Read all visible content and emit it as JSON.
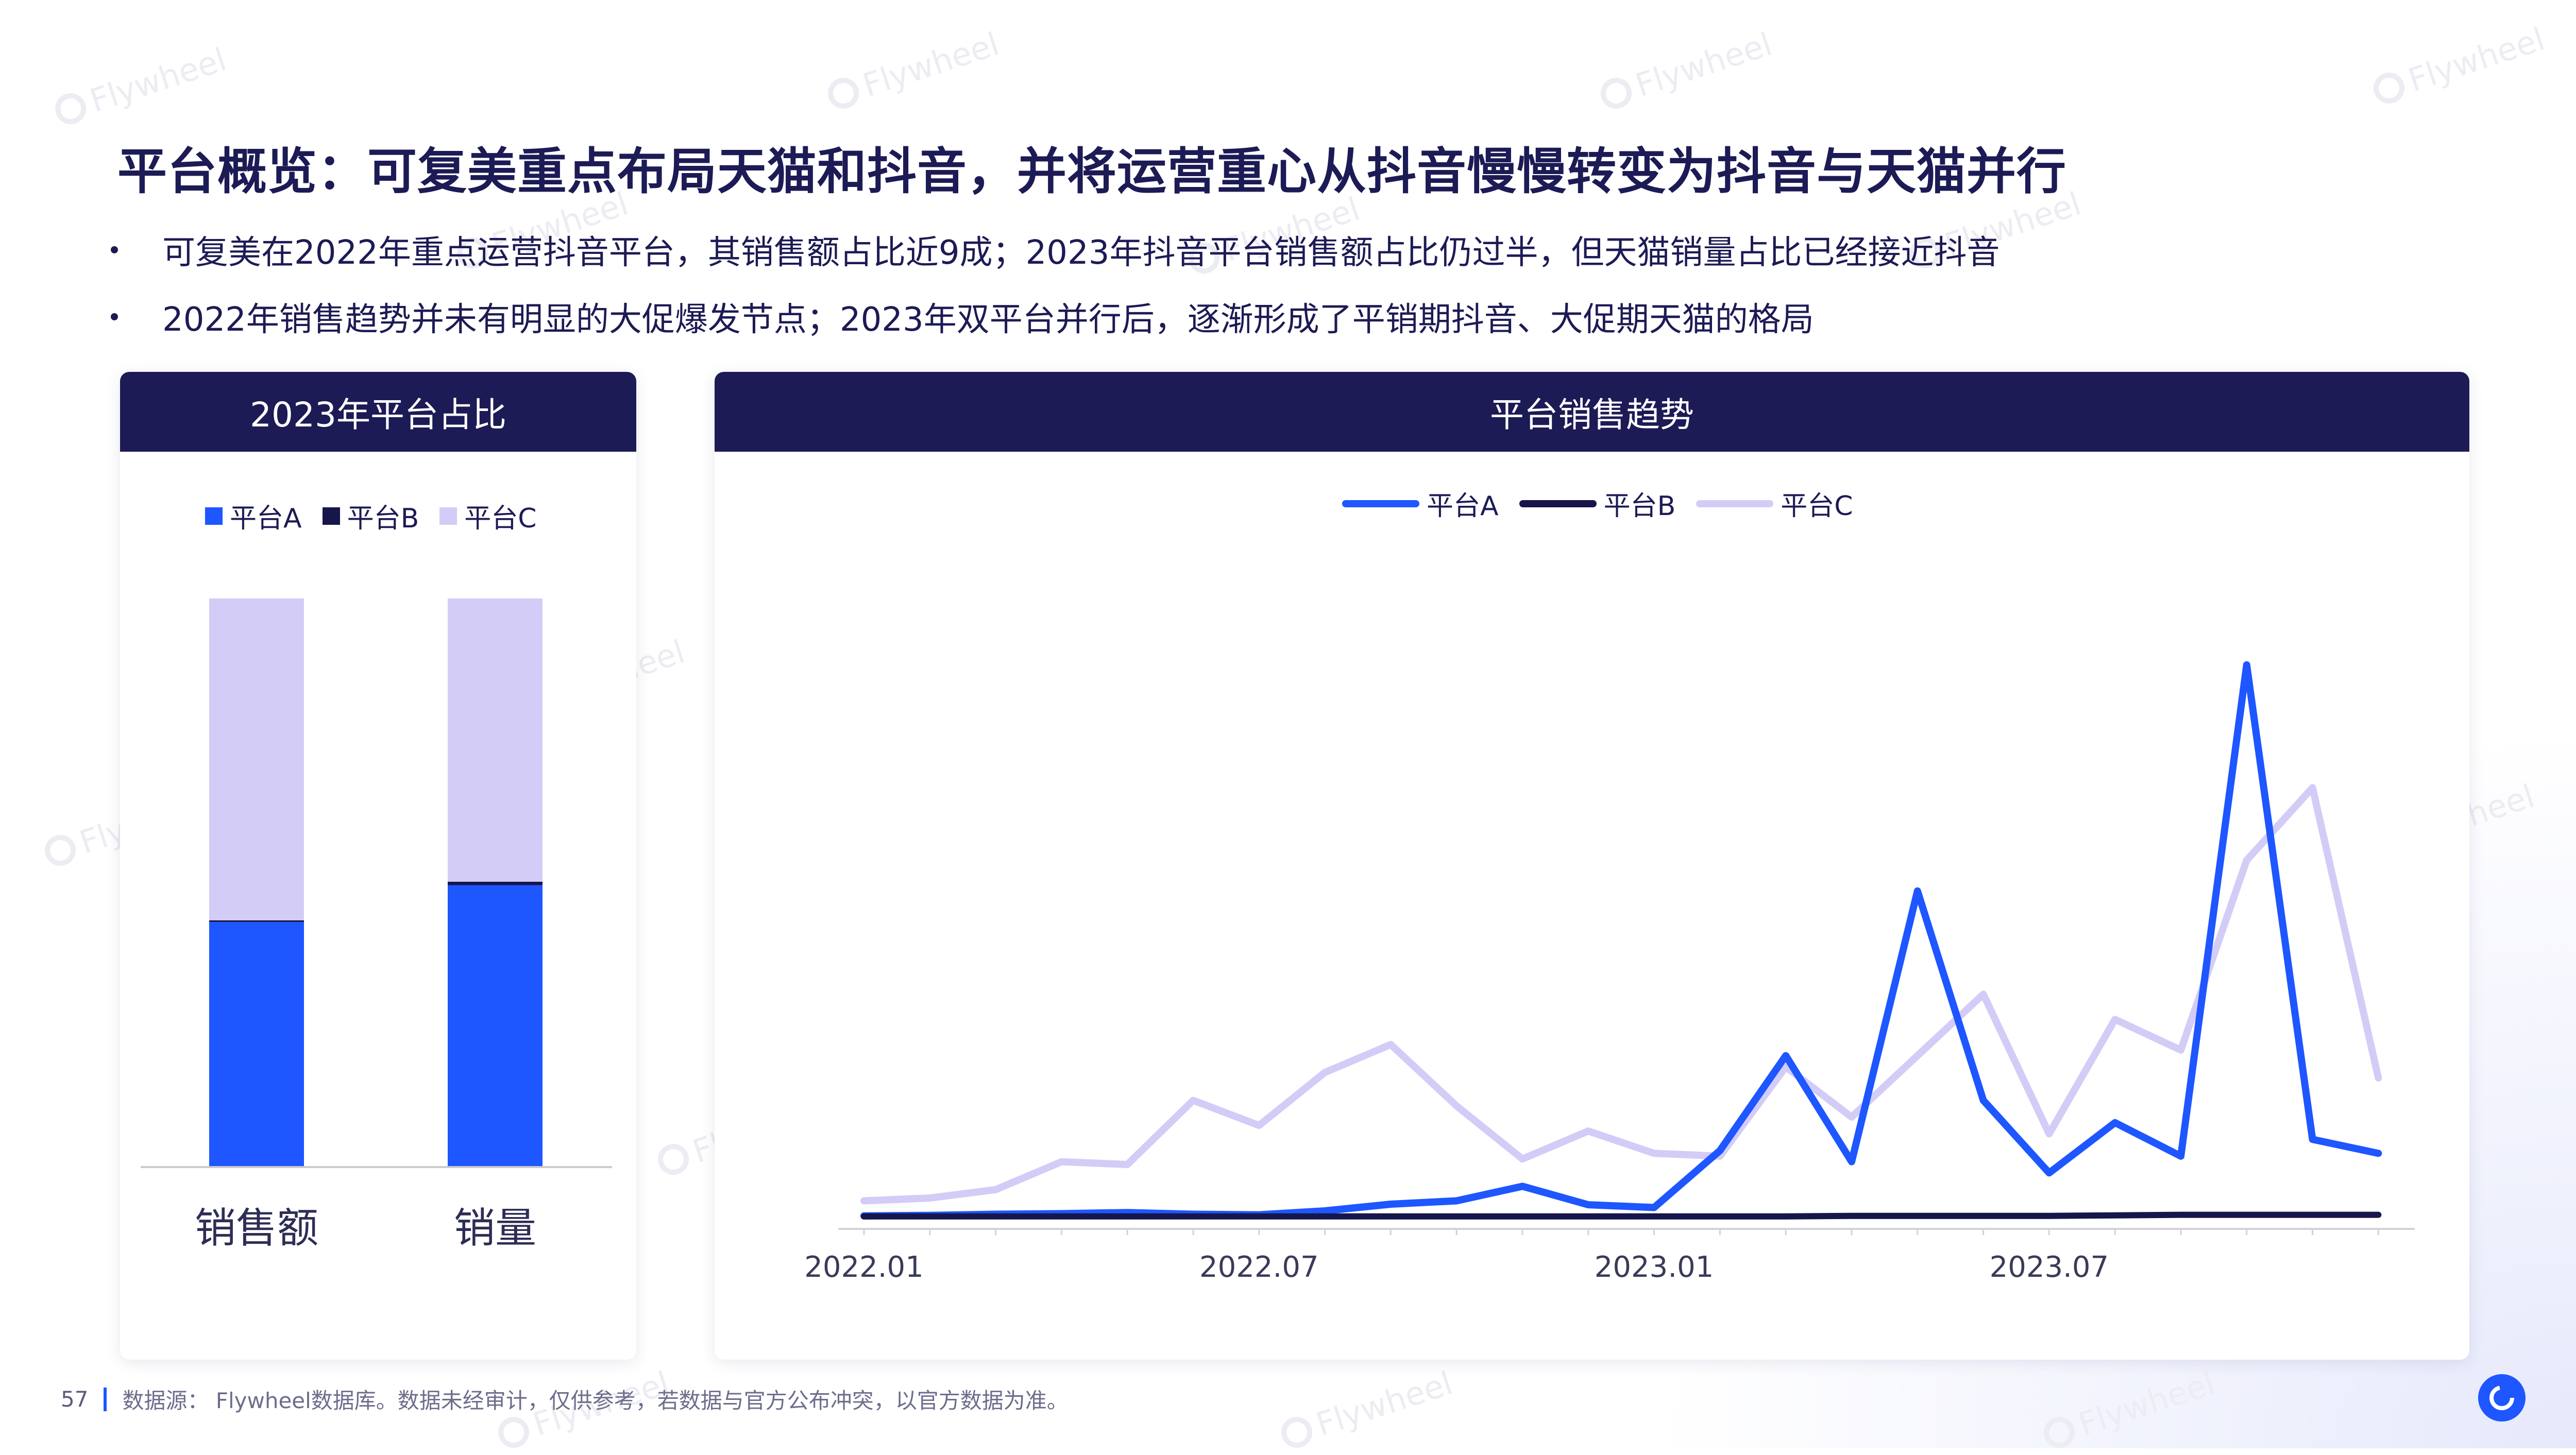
{
  "title": "平台概览：可复美重点布局天猫和抖音，并将运营重心从抖音慢慢转变为抖音与天猫并行",
  "bullets": [
    "可复美在2022年重点运营抖音平台，其销售额占比近9成；2023年抖音平台销售额占比仍过半，但天猫销量占比已经接近抖音",
    "2022年销售趋势并未有明显的大促爆发节点；2023年双平台并行后，逐渐形成了平销期抖音、大促期天猫的格局"
  ],
  "watermark": "Flywheel",
  "colors": {
    "A": "#1e56ff",
    "B": "#16164a",
    "C": "#d3ccf7",
    "header": "#1c1b55"
  },
  "footer": {
    "page": "57",
    "source": "数据源： Flywheel数据库。数据未经审计，仅供参考，若数据与官方公布冲突，以官方数据为准。"
  },
  "chart_data": [
    {
      "type": "bar",
      "stacked": true,
      "title": "2023年平台占比",
      "categories": [
        "销售额",
        "销量"
      ],
      "series": [
        {
          "name": "平台A",
          "values": [
            43,
            49.5
          ]
        },
        {
          "name": "平台B",
          "values": [
            0.3,
            0.6
          ]
        },
        {
          "name": "平台C",
          "values": [
            56.7,
            49.9
          ]
        }
      ],
      "ylim": [
        0,
        100
      ],
      "legend": "top"
    },
    {
      "type": "line",
      "title": "平台销售趋势",
      "x": [
        "2022.01",
        "2022.02",
        "2022.03",
        "2022.04",
        "2022.05",
        "2022.06",
        "2022.07",
        "2022.08",
        "2022.09",
        "2022.10",
        "2022.11",
        "2022.12",
        "2023.01",
        "2023.02",
        "2023.03",
        "2023.04",
        "2023.05",
        "2023.06",
        "2023.07",
        "2023.08",
        "2023.09",
        "2023.10",
        "2023.11",
        "2023.12"
      ],
      "xticks": [
        "2022.01",
        "2022.07",
        "2023.01",
        "2023.07"
      ],
      "series": [
        {
          "name": "平台A",
          "values": [
            0.3,
            0.4,
            0.6,
            0.7,
            0.9,
            0.6,
            0.5,
            1.2,
            2.4,
            3.0,
            5.6,
            2.3,
            1.8,
            12.0,
            29.0,
            10.0,
            58.5,
            21.0,
            8.0,
            17.0,
            11.0,
            99.0,
            14.0,
            11.5
          ]
        },
        {
          "name": "平台B",
          "values": [
            0.2,
            0.2,
            0.2,
            0.2,
            0.2,
            0.2,
            0.2,
            0.2,
            0.2,
            0.2,
            0.2,
            0.2,
            0.2,
            0.2,
            0.2,
            0.3,
            0.3,
            0.3,
            0.3,
            0.4,
            0.5,
            0.5,
            0.5,
            0.5
          ]
        },
        {
          "name": "平台C",
          "values": [
            3.0,
            3.5,
            5.0,
            10.0,
            9.5,
            21.0,
            16.5,
            26.0,
            31.0,
            20.0,
            10.5,
            15.5,
            11.5,
            11.0,
            27.0,
            18.0,
            29.0,
            40.0,
            15.0,
            35.5,
            30.0,
            64.0,
            77.0,
            25.0
          ]
        }
      ],
      "ylim": [
        0,
        100
      ],
      "legend": "top-center",
      "grid": false
    }
  ]
}
